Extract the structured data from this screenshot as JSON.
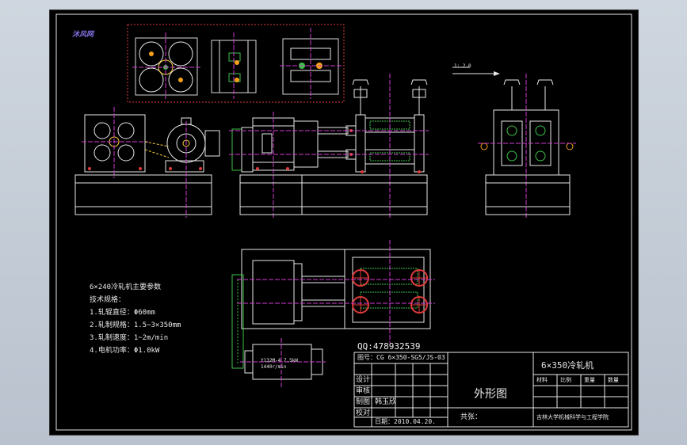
{
  "logo": {
    "text": "沐风网"
  },
  "specs": {
    "title": "6×240冷轧机主要参数",
    "lines": [
      "技术规格：",
      "1.轧辊直径：Φ60mm",
      "2.轧制规格：1.5~3×350mm",
      "3.轧制速度：1~2m/min",
      "4.电机功率：Φ1.0kW"
    ]
  },
  "qq": "QQ:478932539",
  "title_block": {
    "drawing_no": "图号：CG 6×350-SG5/JS-03",
    "machine_name": "6×350冷轧机",
    "view_name": "外形图",
    "rows": [
      "设计",
      "审核",
      "制图",
      "校对"
    ],
    "drafter": "韩玉欣",
    "date": "日期：2010.04.20.",
    "count_label": "共张：",
    "col_headers": [
      "材料",
      "比例",
      "重量",
      "数量"
    ],
    "company": "吉林大学机械科学与工程学院"
  },
  "motor_labels": [
    "Y132M-4 7.5kW",
    "1440r/min"
  ],
  "dim_label": "1: 2.0"
}
